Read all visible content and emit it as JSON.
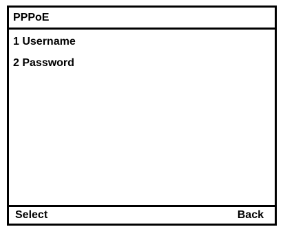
{
  "title": "PPPoE",
  "menu": {
    "items": [
      {
        "number": "1",
        "label": "Username",
        "text": "1 Username"
      },
      {
        "number": "2",
        "label": "Password",
        "text": "2 Password"
      }
    ]
  },
  "softkeys": {
    "left": "Select",
    "right": "Back"
  },
  "colors": {
    "background": "#ffffff",
    "foreground": "#000000"
  }
}
